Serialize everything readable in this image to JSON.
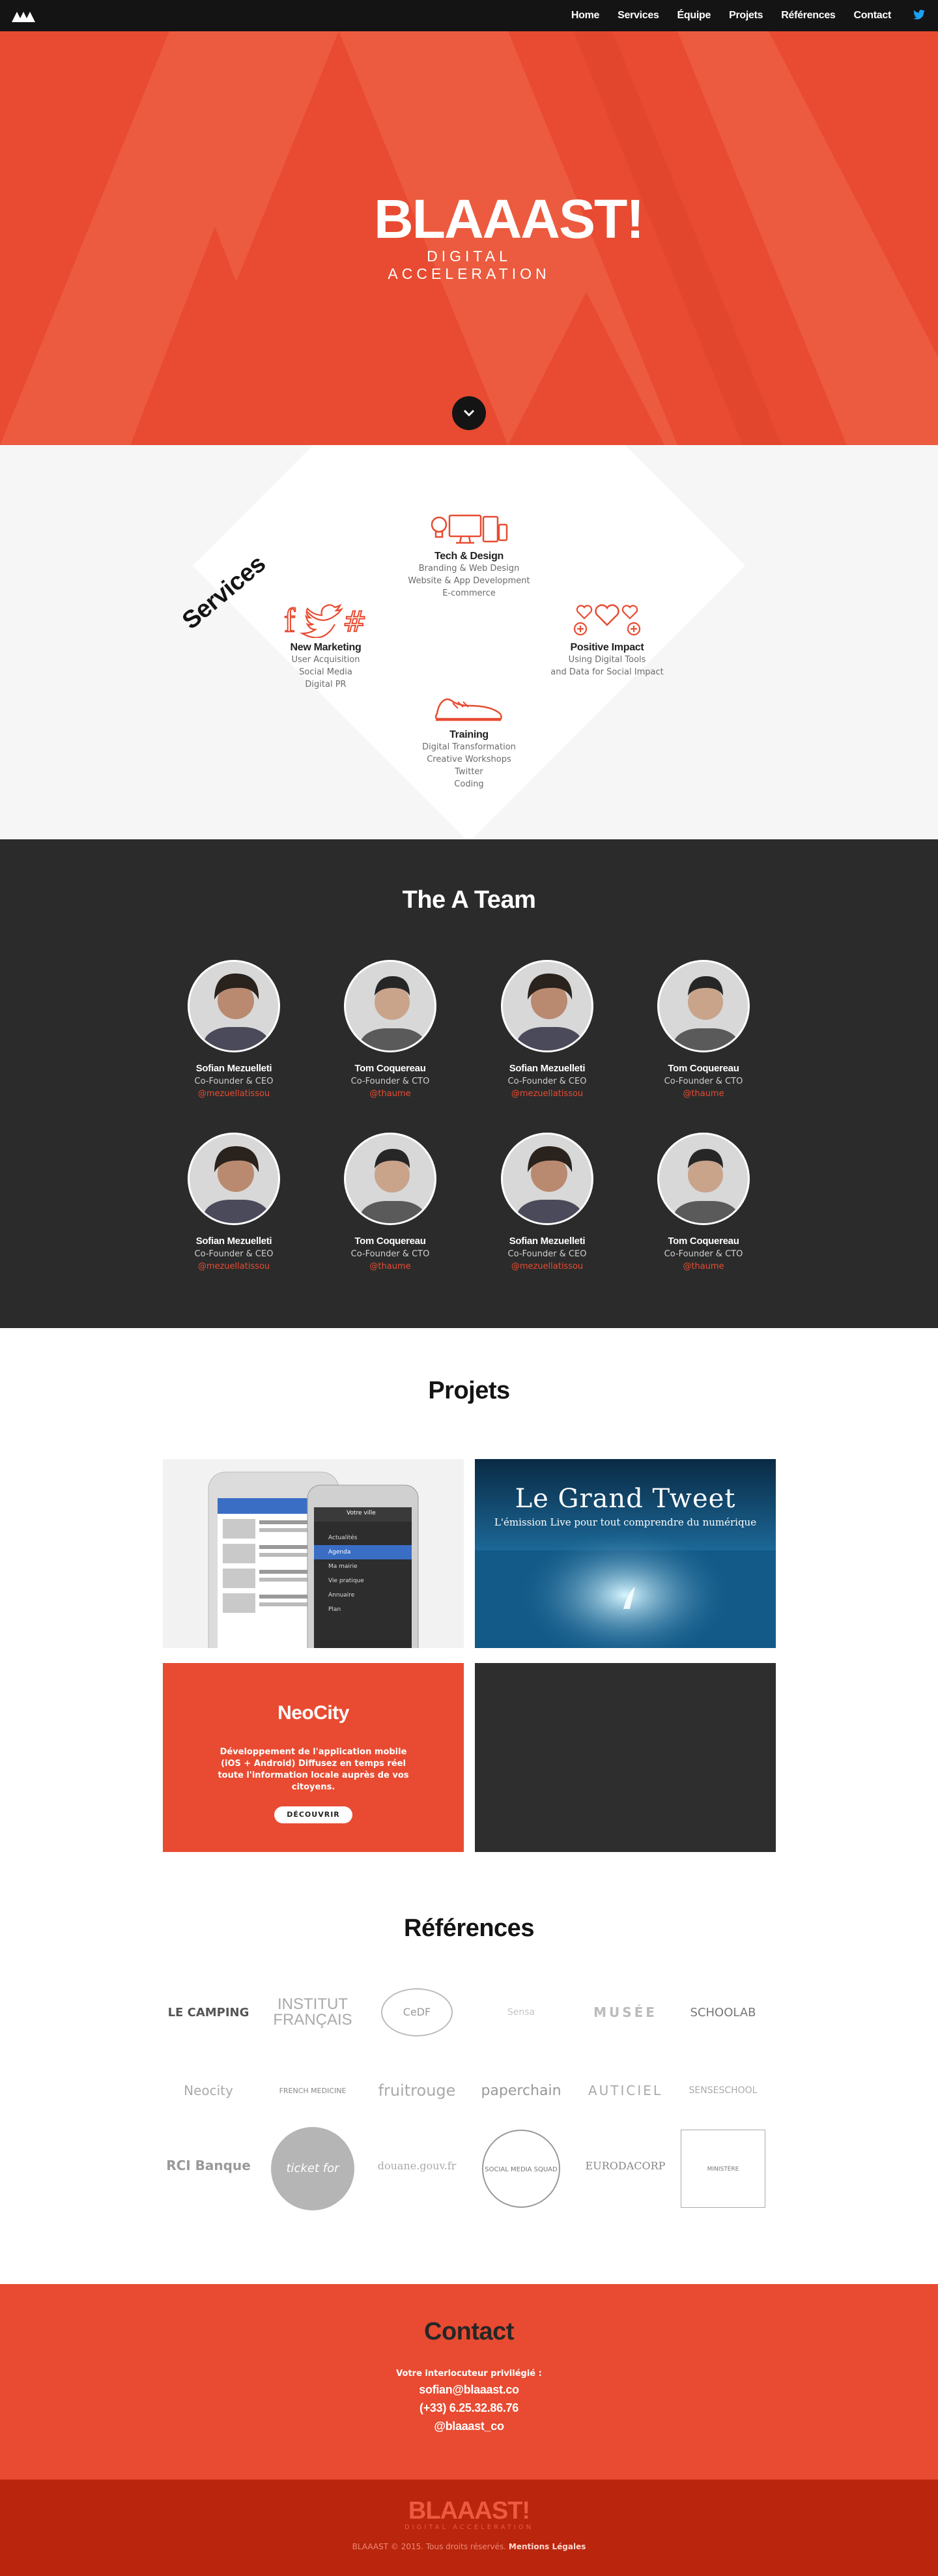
{
  "nav": {
    "items": [
      "Home",
      "Services",
      "Équipe",
      "Projets",
      "Références",
      "Contact"
    ]
  },
  "hero": {
    "brand": "BLAAAST!",
    "tagline": "DIGITAL ACCELERATION"
  },
  "services": {
    "title": "Services",
    "items": [
      {
        "name": "Tech & Design",
        "lines": [
          "Branding & Web Design",
          "Website & App Development",
          "E-commerce"
        ]
      },
      {
        "name": "New Marketing",
        "lines": [
          "User Acquisition",
          "Social Media",
          "Digital PR"
        ]
      },
      {
        "name": "Positive Impact",
        "lines": [
          "Using Digital Tools",
          "and Data for Social Impact"
        ]
      },
      {
        "name": "Training",
        "lines": [
          "Digital Transformation",
          "Creative Workshops",
          "Twitter",
          "Coding"
        ]
      }
    ]
  },
  "team": {
    "title": "The A Team",
    "members": [
      {
        "name": "Sofian Mezuelleti",
        "role": "Co-Founder & CEO",
        "handle": "@mezuellatissou"
      },
      {
        "name": "Tom Coquereau",
        "role": "Co-Founder & CTO",
        "handle": "@thaume"
      },
      {
        "name": "Sofian Mezuelleti",
        "role": "Co-Founder & CEO",
        "handle": "@mezuellatissou"
      },
      {
        "name": "Tom Coquereau",
        "role": "Co-Founder & CTO",
        "handle": "@thaume"
      },
      {
        "name": "Sofian Mezuelleti",
        "role": "Co-Founder & CEO",
        "handle": "@mezuellatissou"
      },
      {
        "name": "Tom Coquereau",
        "role": "Co-Founder & CTO",
        "handle": "@thaume"
      },
      {
        "name": "Sofian Mezuelleti",
        "role": "Co-Founder & CEO",
        "handle": "@mezuellatissou"
      },
      {
        "name": "Tom Coquereau",
        "role": "Co-Founder & CTO",
        "handle": "@thaume"
      }
    ]
  },
  "projects": {
    "title": "Projets",
    "grand_tweet": {
      "title": "Le Grand Tweet",
      "subtitle": "L'émission Live pour tout comprendre du numérique"
    },
    "neocity": {
      "title": "NeoCity",
      "description": "Développement de l'application mobile (iOS + Android) Diffusez en temps réel toute l'information locale auprès de vos citoyens.",
      "button": "DÉCOUVRIR"
    },
    "phone_screen": {
      "header": "Votre ville",
      "menu": [
        "Actualités",
        "Agenda",
        "Ma mairie",
        "Vie pratique",
        "Annuaire",
        "Plan"
      ]
    }
  },
  "references": {
    "title": "Références",
    "logos": [
      "LE CAMPING",
      "INSTITUT FRANÇAIS",
      "CeDF",
      "Sensa",
      "MUSÉE",
      "SCHOOLAB",
      "Neocity",
      "FRENCH MEDICINE",
      "fruitrouge",
      "paperchain",
      "AUTICIEL",
      "SENSESCHOOL",
      "RCI Banque",
      "ticket for change",
      "douane.gouv.fr",
      "SOCIAL MEDIA SQUAD",
      "EURODACORP",
      "MINISTÈRE"
    ]
  },
  "contact": {
    "title": "Contact",
    "label": "Votre interlocuteur privilégié :",
    "email": "sofian@blaaast.co",
    "phone": "(+33) 6.25.32.86.76",
    "twitter": "@blaaast_co"
  },
  "footer": {
    "brand": "BLAAAST!",
    "tagline": "DIGITAL ACCELERATION",
    "copyright": "BLAAAST © 2015. Tous droits réservés.",
    "legal": "Mentions Légales"
  },
  "colors": {
    "accent": "#e84b31",
    "dark": "#2b2b2b",
    "nav": "#141414"
  }
}
